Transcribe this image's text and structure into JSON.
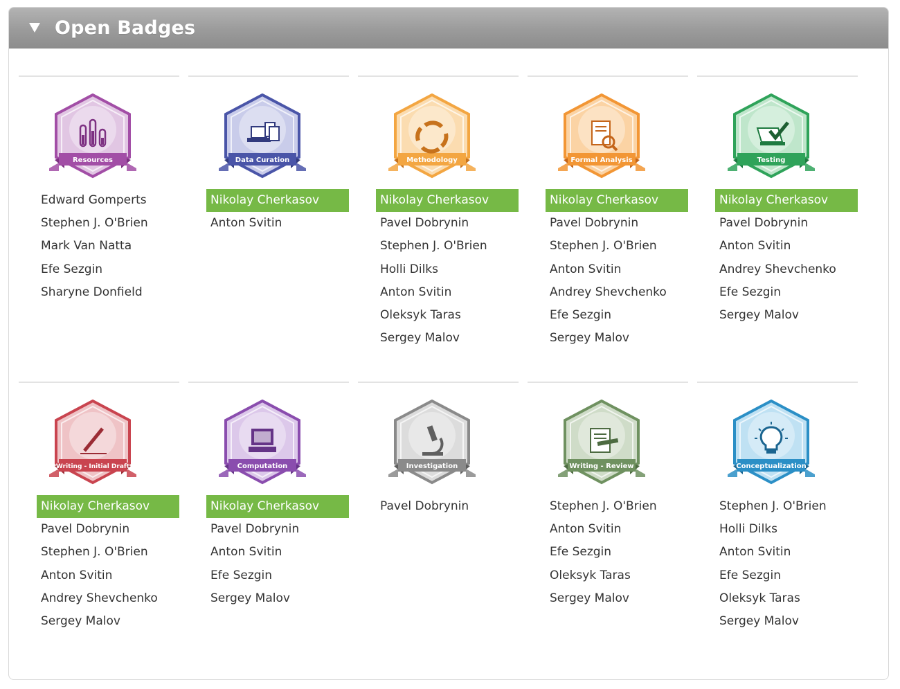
{
  "section": {
    "title": "Open Badges",
    "toggle_icon": "triangle-down-icon",
    "expanded": true
  },
  "colors": {
    "highlight": "#76b946",
    "header": "#9b9b9b"
  },
  "badges": [
    {
      "label": "Resources",
      "icon": "test-tubes-icon",
      "color": "#a24ea6",
      "light": "#e1c6e3",
      "dark": "#7d3182",
      "highlighted": false,
      "contributors": [
        "Edward Gomperts",
        "Stephen J. O'Brien",
        "Mark Van Natta",
        "Efe Sezgin",
        "Sharyne Donfield"
      ]
    },
    {
      "label": "Data Curation",
      "icon": "laptop-documents-icon",
      "color": "#4a55a8",
      "light": "#c9ccea",
      "dark": "#323b7e",
      "highlighted": true,
      "contributors": [
        "Nikolay Cherkasov",
        "Anton Svitin"
      ]
    },
    {
      "label": "Methodology",
      "icon": "cycle-arrows-icon",
      "color": "#f3a642",
      "light": "#fbdcb0",
      "dark": "#c7721c",
      "highlighted": true,
      "contributors": [
        "Nikolay Cherkasov",
        "Pavel Dobrynin",
        "Stephen J. O'Brien",
        "Holli Dilks",
        "Anton Svitin",
        "Oleksyk Taras",
        "Sergey Malov"
      ]
    },
    {
      "label": "Formal Analysis",
      "icon": "magnifier-document-icon",
      "color": "#f29635",
      "light": "#fbd3a4",
      "dark": "#c4651a",
      "highlighted": true,
      "contributors": [
        "Nikolay Cherkasov",
        "Pavel Dobrynin",
        "Stephen J. O'Brien",
        "Anton Svitin",
        "Andrey Shevchenko",
        "Efe Sezgin",
        "Sergey Malov"
      ]
    },
    {
      "label": "Testing",
      "icon": "laptop-checkmark-icon",
      "color": "#2fa35a",
      "light": "#bfe6cb",
      "dark": "#1e7a40",
      "highlighted": true,
      "contributors": [
        "Nikolay Cherkasov",
        "Pavel Dobrynin",
        "Anton Svitin",
        "Andrey Shevchenko",
        "Efe Sezgin",
        "Sergey Malov"
      ]
    },
    {
      "label": "Writing - Initial Draft",
      "icon": "pen-icon",
      "color": "#c9444f",
      "light": "#efc3c6",
      "dark": "#9b2c35",
      "highlighted": true,
      "contributors": [
        "Nikolay Cherkasov",
        "Pavel Dobrynin",
        "Stephen J. O'Brien",
        "Anton Svitin",
        "Andrey Shevchenko",
        "Sergey Malov"
      ]
    },
    {
      "label": "Computation",
      "icon": "computer-icon",
      "color": "#8a4dae",
      "light": "#dcc8ea",
      "dark": "#653487",
      "highlighted": true,
      "contributors": [
        "Nikolay Cherkasov",
        "Pavel Dobrynin",
        "Anton Svitin",
        "Efe Sezgin",
        "Sergey Malov"
      ]
    },
    {
      "label": "Investigation",
      "icon": "microscope-icon",
      "color": "#8a8a8a",
      "light": "#dcdcdc",
      "dark": "#5f5f5f",
      "highlighted": false,
      "contributors": [
        "Pavel Dobrynin"
      ]
    },
    {
      "label": "Writing - Review",
      "icon": "document-review-icon",
      "color": "#6f9160",
      "light": "#cfdcc8",
      "dark": "#4d6b41",
      "highlighted": false,
      "contributors": [
        "Stephen J. O'Brien",
        "Anton Svitin",
        "Efe Sezgin",
        "Oleksyk Taras",
        "Sergey Malov"
      ]
    },
    {
      "label": "Conceptualization",
      "icon": "lightbulb-icon",
      "color": "#2b8fc6",
      "light": "#bfe1f3",
      "dark": "#1b6590",
      "highlighted": false,
      "contributors": [
        "Stephen J. O'Brien",
        "Holli Dilks",
        "Anton Svitin",
        "Efe Sezgin",
        "Oleksyk Taras",
        "Sergey Malov"
      ]
    }
  ]
}
